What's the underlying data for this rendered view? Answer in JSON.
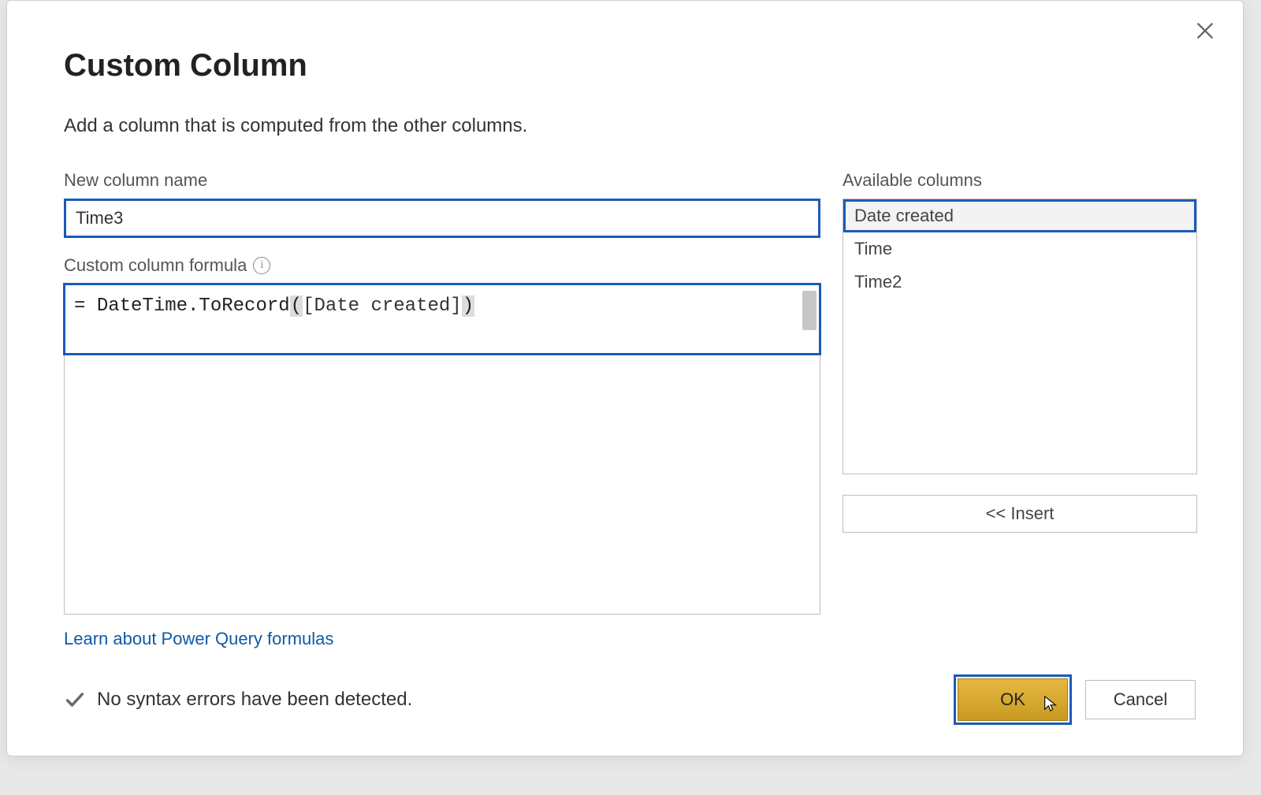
{
  "title": "Custom Column",
  "subtitle": "Add a column that is computed from the other columns.",
  "labels": {
    "new_column_name": "New column name",
    "formula": "Custom column formula",
    "available_columns": "Available columns"
  },
  "inputs": {
    "column_name_value": "Time3",
    "formula_prefix": "= ",
    "formula_function": "DateTime.ToRecord",
    "formula_open": "(",
    "formula_colref": "[Date created]",
    "formula_close": ")"
  },
  "available_columns": [
    {
      "label": "Date created",
      "selected": true
    },
    {
      "label": "Time",
      "selected": false
    },
    {
      "label": "Time2",
      "selected": false
    }
  ],
  "buttons": {
    "insert": "<< Insert",
    "ok": "OK",
    "cancel": "Cancel"
  },
  "link": "Learn about Power Query formulas",
  "status_message": "No syntax errors have been detected."
}
